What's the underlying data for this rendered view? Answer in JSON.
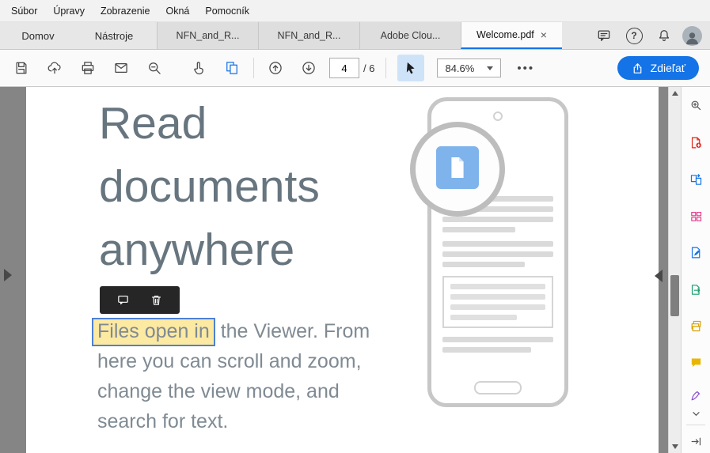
{
  "menu_bar": {
    "items": [
      "Súbor",
      "Úpravy",
      "Zobrazenie",
      "Okná",
      "Pomocník"
    ]
  },
  "tab_bar": {
    "app_tabs": [
      "Domov",
      "Nástroje"
    ],
    "doc_tabs": [
      {
        "label": "NFN_and_R..."
      },
      {
        "label": "NFN_and_R..."
      },
      {
        "label": "Adobe Clou..."
      },
      {
        "label": "Welcome.pdf",
        "close_glyph": "×",
        "active": true
      }
    ],
    "right_icons": [
      "comment-icon",
      "help-icon",
      "bell-icon",
      "avatar"
    ],
    "help_glyph": "?"
  },
  "toolbar": {
    "icons": [
      "save-icon",
      "cloud-upload-icon",
      "print-icon",
      "email-icon",
      "zoom-out-icon",
      "touch-select-icon",
      "page-view-icon",
      "previous-page-icon",
      "next-page-icon",
      "select-tool-icon",
      "more-icon",
      "share-icon"
    ],
    "page_number": "4",
    "page_total": "/ 6",
    "zoom_level": "84.6%",
    "more_glyph": "•••",
    "share_label": "Zdieľať"
  },
  "document": {
    "heading_lines": [
      "Read",
      "documents",
      "anywhere"
    ],
    "body": {
      "highlighted_text": "Files open in",
      "line1_rest": " the Viewer. From",
      "line2": "here you can scroll and zoom,",
      "line3": "change the view mode, and",
      "line4": "search for text."
    }
  },
  "selection_toolbar": {
    "icons": [
      "add-comment-icon",
      "delete-icon"
    ]
  },
  "tools_pane": {
    "items": [
      {
        "name": "zoom-tools-icon",
        "color": "#555555"
      },
      {
        "name": "create-pdf-icon",
        "color": "#e2231a"
      },
      {
        "name": "convert-pdf-icon",
        "color": "#1473e6"
      },
      {
        "name": "organize-pages-icon",
        "color": "#e9398a"
      },
      {
        "name": "edit-pdf-icon",
        "color": "#1473e6"
      },
      {
        "name": "send-file-icon",
        "color": "#169e6c"
      },
      {
        "name": "combine-files-icon",
        "color": "#d8a200"
      },
      {
        "name": "comment-tool-icon",
        "color": "#e8b600"
      },
      {
        "name": "fill-sign-icon",
        "color": "#8a4fd0"
      },
      {
        "name": "more-tools-chevron-icon",
        "color": "#555555"
      },
      {
        "name": "collapse-pane-icon",
        "color": "#555555"
      }
    ]
  },
  "colors": {
    "accent_blue": "#1473e6",
    "canvas_gray": "#858585",
    "highlight_yellow": "#fce9a2",
    "highlight_border": "#4e81d2",
    "heading_text": "#67757f",
    "body_text": "#7f8a93"
  }
}
